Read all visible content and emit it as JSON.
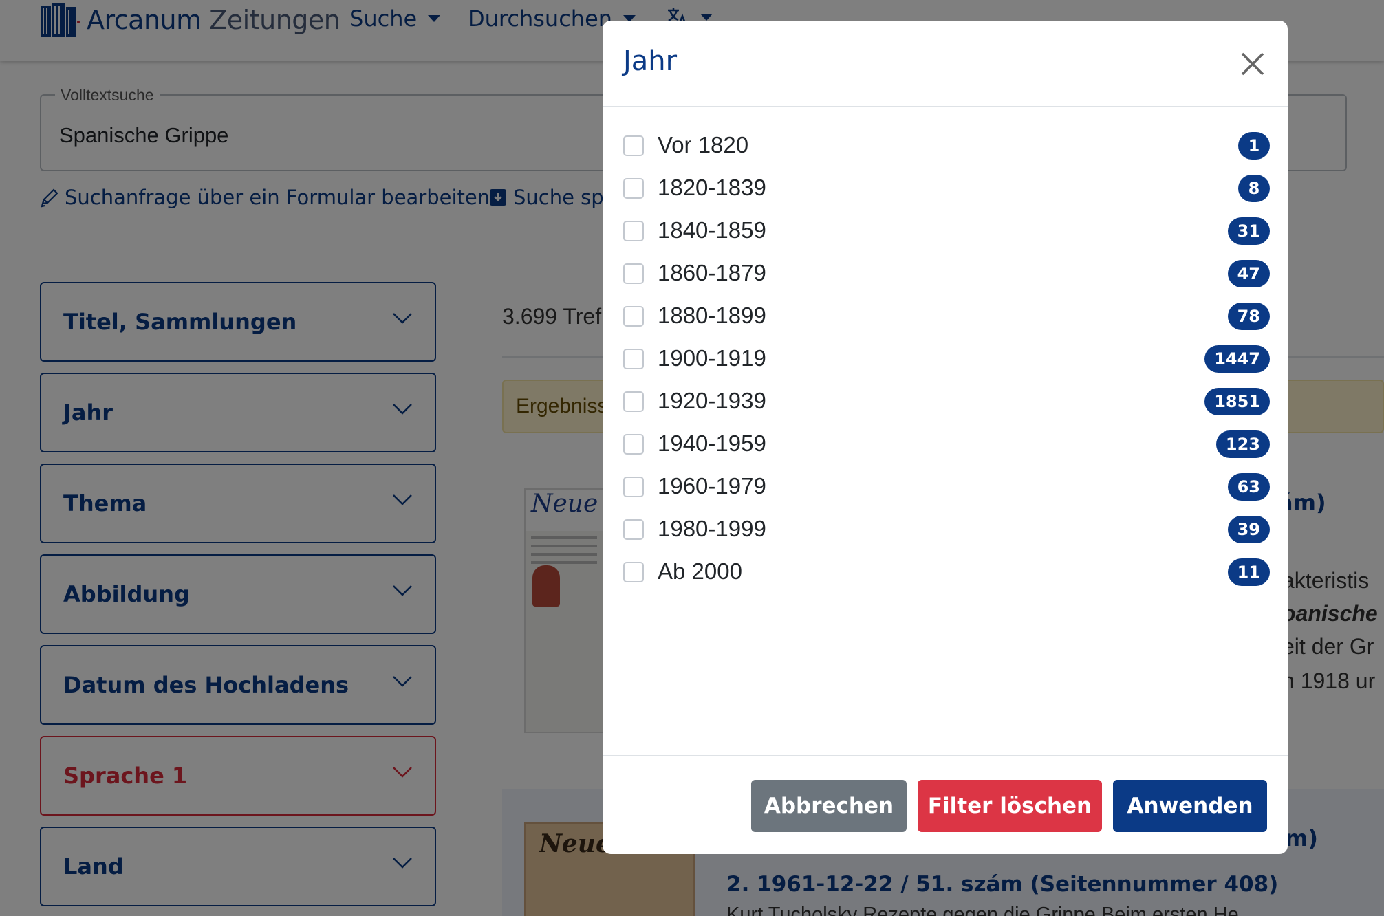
{
  "navbar": {
    "brand_main": "Arcanum",
    "brand_sub": "Zeitungen",
    "menu": [
      {
        "label": "Suche"
      },
      {
        "label": "Durchsuchen"
      }
    ]
  },
  "search": {
    "legend": "Volltextsuche",
    "value": "Spanische Grippe"
  },
  "actions": {
    "edit_form": "Suchanfrage über ein Formular bearbeiten",
    "save_search": "Suche spe"
  },
  "facets": [
    {
      "label": "Titel, Sammlungen"
    },
    {
      "label": "Jahr"
    },
    {
      "label": "Thema"
    },
    {
      "label": "Abbildung"
    },
    {
      "label": "Datum des Hochladens"
    },
    {
      "label": "Sprache 1"
    },
    {
      "label": "Land"
    }
  ],
  "results": {
    "count": "3.699 Tref",
    "alert": "Ergebniss",
    "thumb1_title": "Neue",
    "thumb2_title": "Neue",
    "item2_title": "2. 1961-12-22 / 51. szám (Seitennummer 408)",
    "item2_snippet": "Kurt Tucholsky Rezepte gegen die Grippe Beim ersten He",
    "peek_1": "ám)",
    "peek_2": "akteristis",
    "peek_3": "oanische",
    "peek_4": "eit der Gr",
    "peek_5": "n 1918 ur",
    "peek_6": "m)"
  },
  "modal": {
    "title": "Jahr",
    "options": [
      {
        "label": "Vor 1820",
        "count": "1",
        "checked": false
      },
      {
        "label": "1820-1839",
        "count": "8",
        "checked": false
      },
      {
        "label": "1840-1859",
        "count": "31",
        "checked": false
      },
      {
        "label": "1860-1879",
        "count": "47",
        "checked": false
      },
      {
        "label": "1880-1899",
        "count": "78",
        "checked": false
      },
      {
        "label": "1900-1919",
        "count": "1447",
        "checked": false
      },
      {
        "label": "1920-1939",
        "count": "1851",
        "checked": false
      },
      {
        "label": "1940-1959",
        "count": "123",
        "checked": false
      },
      {
        "label": "1960-1979",
        "count": "63",
        "checked": false
      },
      {
        "label": "1980-1999",
        "count": "39",
        "checked": false
      },
      {
        "label": "Ab 2000",
        "count": "11",
        "checked": false
      }
    ],
    "buttons": {
      "cancel": "Abbrechen",
      "clear": "Filter löschen",
      "apply": "Anwenden"
    }
  },
  "colors": {
    "primary": "#0b3a86",
    "danger": "#dc3545",
    "secondary": "#6c757d",
    "backdrop": "rgba(0,0,0,0.5)"
  }
}
